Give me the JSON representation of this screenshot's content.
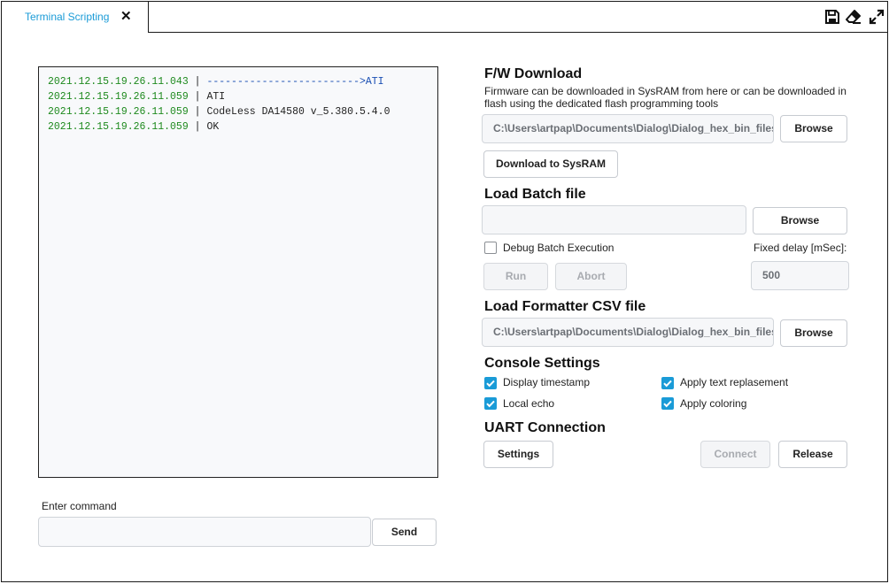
{
  "tab": {
    "label": "Terminal Scripting",
    "close_symbol": "✕"
  },
  "toolbar": {
    "icons": [
      "save-icon",
      "eraser-icon",
      "expand-icon"
    ]
  },
  "console": {
    "lines": [
      {
        "timestamp": "2021.12.15.19.26.11.043",
        "separator": " | ",
        "text": "------------------------->ATI",
        "kind": "tx"
      },
      {
        "timestamp": "2021.12.15.19.26.11.059",
        "separator": " | ",
        "text": "ATI",
        "kind": "rx"
      },
      {
        "timestamp": "2021.12.15.19.26.11.059",
        "separator": " | ",
        "text": "CodeLess DA14580 v_5.380.5.4.0",
        "kind": "rx"
      },
      {
        "timestamp": "2021.12.15.19.26.11.059",
        "separator": " | ",
        "text": "OK",
        "kind": "rx"
      }
    ]
  },
  "command": {
    "label": "Enter command",
    "value": "",
    "placeholder": "",
    "send_label": "Send"
  },
  "fw_download": {
    "title": "F/W Download",
    "description": "Firmware can be downloaded in SysRAM from here or can be downloaded in flash using the dedicated flash programming tools",
    "path": "C:\\Users\\artpap\\Documents\\Dialog\\Dialog_hex_bin_files",
    "browse_label": "Browse",
    "download_label": "Download to SysRAM"
  },
  "batch": {
    "title": "Load Batch file",
    "path": "",
    "browse_label": "Browse",
    "debug_label": "Debug Batch Execution",
    "debug_checked": false,
    "delay_label": "Fixed delay [mSec]:",
    "delay_value": "500",
    "run_label": "Run",
    "abort_label": "Abort"
  },
  "formatter": {
    "title": "Load Formatter CSV file",
    "path": "C:\\Users\\artpap\\Documents\\Dialog\\Dialog_hex_bin_files",
    "browse_label": "Browse"
  },
  "console_settings": {
    "title": "Console Settings",
    "display_timestamp": "Display timestamp",
    "local_echo": "Local echo",
    "apply_text_replacement": "Apply text replasement",
    "apply_coloring": "Apply coloring"
  },
  "uart": {
    "title": "UART Connection",
    "settings_label": "Settings",
    "connect_label": "Connect",
    "release_label": "Release"
  },
  "colors": {
    "accent": "#1a9bd7",
    "timestamp": "#1e8a1e",
    "tx": "#1a4fb3"
  }
}
